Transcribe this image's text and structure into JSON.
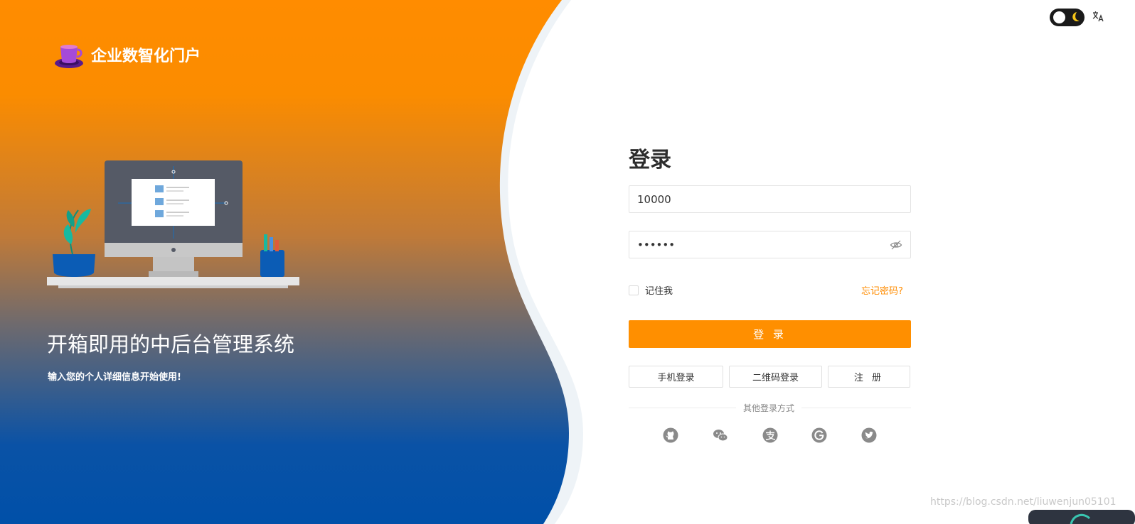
{
  "brand": {
    "title": "企业数智化门户"
  },
  "hero": {
    "title": "开箱即用的中后台管理系统",
    "subtitle": "输入您的个人详细信息开始使用!"
  },
  "login": {
    "title": "登录",
    "username_value": "10000",
    "password_value": "••••••",
    "remember_label": "记住我",
    "forgot_label": "忘记密码?",
    "submit_label": "登 录",
    "alt_buttons": {
      "phone": "手机登录",
      "qr": "二维码登录",
      "register": "注 册"
    },
    "other_methods_label": "其他登录方式",
    "social_icons": [
      "github-icon",
      "wechat-icon",
      "alipay-icon",
      "google-icon",
      "twitter-icon"
    ]
  },
  "watermark": "https://blog.csdn.net/liuwenjun05101",
  "colors": {
    "accent": "#ff8f00",
    "gradient_top": "#ff8c00",
    "gradient_bottom": "#0050a8",
    "link": "#ff8c00"
  }
}
